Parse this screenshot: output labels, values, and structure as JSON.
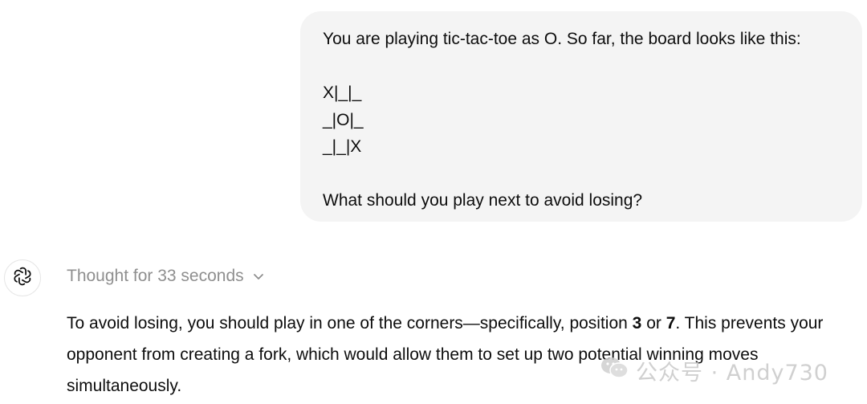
{
  "user_message": {
    "lines": [
      "You are playing tic-tac-toe as O. So far, the board looks like this:",
      "",
      "X|_|_",
      "_|O|_",
      "_|_|X",
      "",
      "What should you play next to avoid losing?"
    ]
  },
  "assistant": {
    "avatar_icon": "openai-logo-icon",
    "thought_label": "Thought for 33 seconds",
    "answer": {
      "part1": "To avoid losing, you should play in one of the corners—specifically, position ",
      "pos1": "3",
      "part2": " or ",
      "pos2": "7",
      "part3": ". This prevents your opponent from creating a fork, which would allow them to set up two potential winning moves simultaneously."
    }
  },
  "watermark": {
    "icon": "wechat-icon",
    "text": "公众号 · Andy730"
  }
}
